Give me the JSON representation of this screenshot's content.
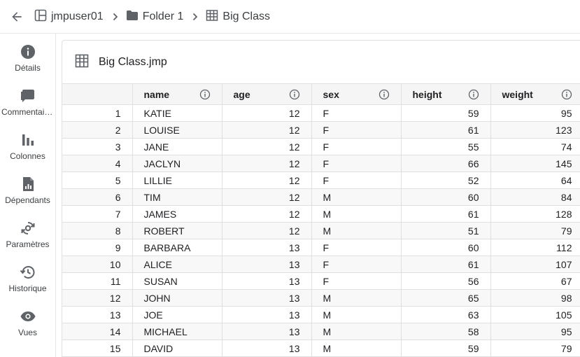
{
  "breadcrumb": {
    "items": [
      {
        "label": "jmpuser01",
        "icon": "workspace-icon"
      },
      {
        "label": "Folder 1",
        "icon": "folder-icon"
      },
      {
        "label": "Big Class",
        "icon": "table-icon"
      }
    ]
  },
  "sidebar": {
    "items": [
      {
        "label": "Détails",
        "icon": "info-icon"
      },
      {
        "label": "Commentaires",
        "icon": "comment-icon"
      },
      {
        "label": "Colonnes",
        "icon": "columns-icon"
      },
      {
        "label": "Dépendants",
        "icon": "dependents-icon"
      },
      {
        "label": "Paramètres",
        "icon": "settings-icon"
      },
      {
        "label": "Historique",
        "icon": "history-icon"
      },
      {
        "label": "Vues",
        "icon": "eye-icon"
      }
    ]
  },
  "panel": {
    "title": "Big Class.jmp"
  },
  "table": {
    "columns": [
      "name",
      "age",
      "sex",
      "height",
      "weight"
    ],
    "rows": [
      [
        "1",
        "KATIE",
        "12",
        "F",
        "59",
        "95"
      ],
      [
        "2",
        "LOUISE",
        "12",
        "F",
        "61",
        "123"
      ],
      [
        "3",
        "JANE",
        "12",
        "F",
        "55",
        "74"
      ],
      [
        "4",
        "JACLYN",
        "12",
        "F",
        "66",
        "145"
      ],
      [
        "5",
        "LILLIE",
        "12",
        "F",
        "52",
        "64"
      ],
      [
        "6",
        "TIM",
        "12",
        "M",
        "60",
        "84"
      ],
      [
        "7",
        "JAMES",
        "12",
        "M",
        "61",
        "128"
      ],
      [
        "8",
        "ROBERT",
        "12",
        "M",
        "51",
        "79"
      ],
      [
        "9",
        "BARBARA",
        "13",
        "F",
        "60",
        "112"
      ],
      [
        "10",
        "ALICE",
        "13",
        "F",
        "61",
        "107"
      ],
      [
        "11",
        "SUSAN",
        "13",
        "F",
        "56",
        "67"
      ],
      [
        "12",
        "JOHN",
        "13",
        "M",
        "65",
        "98"
      ],
      [
        "13",
        "JOE",
        "13",
        "M",
        "63",
        "105"
      ],
      [
        "14",
        "MICHAEL",
        "13",
        "M",
        "58",
        "95"
      ],
      [
        "15",
        "DAVID",
        "13",
        "M",
        "59",
        "79"
      ]
    ]
  }
}
